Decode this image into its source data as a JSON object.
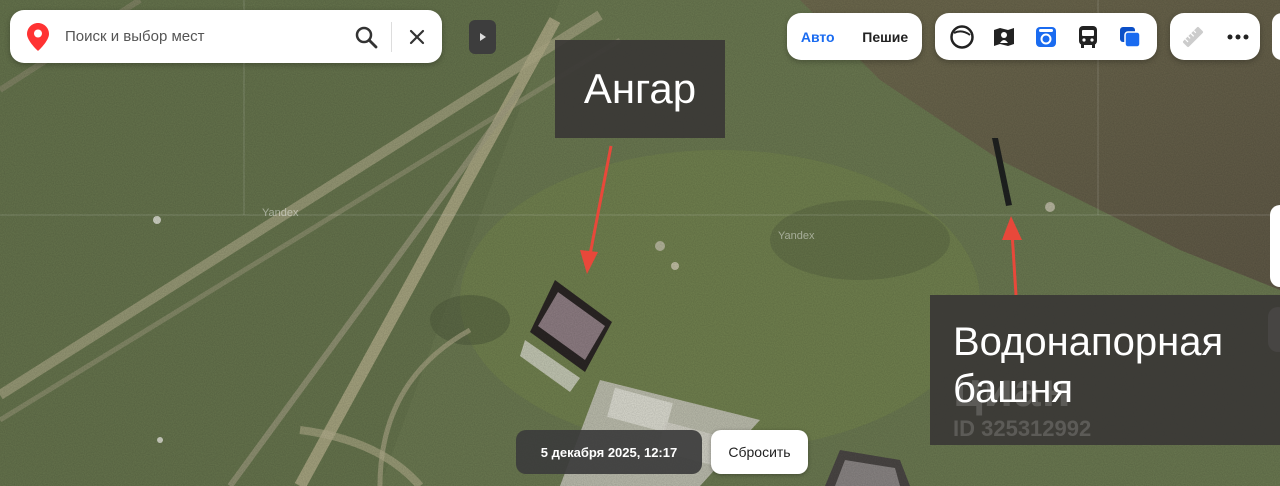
{
  "search": {
    "placeholder": "Поиск и выбор мест"
  },
  "routing": {
    "auto_label": "Авто",
    "walk_label": "Пешие"
  },
  "layers": {
    "items": [
      {
        "icon": "circle-layer-icon"
      },
      {
        "icon": "panorama-icon"
      },
      {
        "icon": "camera-icon"
      },
      {
        "icon": "bus-icon"
      },
      {
        "icon": "layers-icon"
      }
    ]
  },
  "tools": {
    "items": [
      {
        "icon": "ruler-icon"
      },
      {
        "icon": "more-icon"
      }
    ]
  },
  "annotations": {
    "hangar": "Ангар",
    "tower_line1": "Водонапорная",
    "tower_line2": "башня"
  },
  "watermark": {
    "brand": "циан",
    "id": "ID 325312992"
  },
  "map_watermarks": [
    "Yandex",
    "Yandex"
  ],
  "history": {
    "date": "5 декабря 2025, 12:17",
    "reset_label": "Сбросить"
  },
  "colors": {
    "accent": "#1a6bf0",
    "pin": "#f33",
    "arrow": "#e8483a"
  }
}
